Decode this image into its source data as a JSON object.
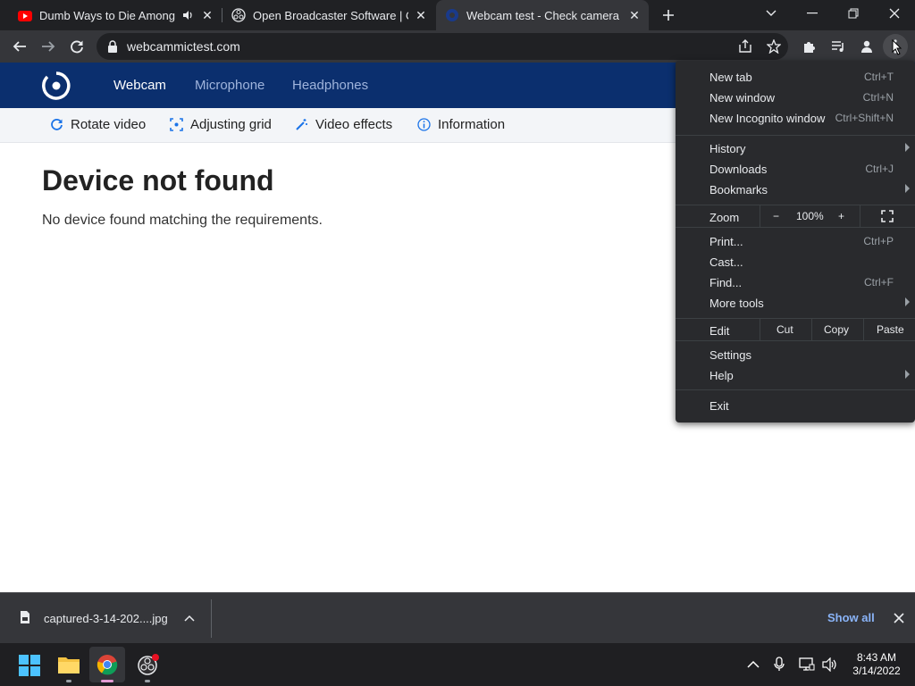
{
  "tabs": [
    {
      "title": "Dumb Ways to Die Among Us",
      "favicon": "youtube-icon"
    },
    {
      "title": "Open Broadcaster Software | OBS",
      "favicon": "obs-icon"
    },
    {
      "title": "Webcam test - Check camera online",
      "favicon": "webcam-site-icon"
    }
  ],
  "toolbar": {
    "url": "webcammictest.com"
  },
  "site": {
    "nav": [
      "Webcam",
      "Microphone",
      "Headphones"
    ],
    "subnav": [
      "Rotate video",
      "Adjusting grid",
      "Video effects",
      "Information"
    ],
    "heading": "Device not found",
    "message": "No device found matching the requirements."
  },
  "menu": {
    "new_tab": "New tab",
    "new_tab_sc": "Ctrl+T",
    "new_window": "New window",
    "new_window_sc": "Ctrl+N",
    "incognito": "New Incognito window",
    "incognito_sc": "Ctrl+Shift+N",
    "history": "History",
    "downloads": "Downloads",
    "downloads_sc": "Ctrl+J",
    "bookmarks": "Bookmarks",
    "zoom": "Zoom",
    "zoom_minus": "−",
    "zoom_value": "100%",
    "zoom_plus": "+",
    "print": "Print...",
    "print_sc": "Ctrl+P",
    "cast": "Cast...",
    "find": "Find...",
    "find_sc": "Ctrl+F",
    "more_tools": "More tools",
    "edit": "Edit",
    "cut": "Cut",
    "copy": "Copy",
    "paste": "Paste",
    "settings": "Settings",
    "help": "Help",
    "exit": "Exit"
  },
  "download": {
    "file": "captured-3-14-202....jpg",
    "show_all": "Show all"
  },
  "taskbar": {
    "time": "8:43 AM",
    "date": "3/14/2022"
  },
  "colors": {
    "site_nav": "#0b2f6e",
    "accent_link": "#8ab4f8",
    "menu_bg": "#292a2d"
  }
}
